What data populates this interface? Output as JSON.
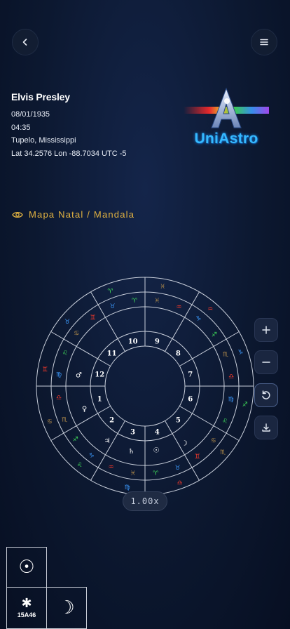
{
  "nav": {
    "back_icon": "chevron-left-icon",
    "menu_icon": "hamburger-menu-icon"
  },
  "profile": {
    "name": "Elvis Presley",
    "date": "08/01/1935",
    "time": "04:35",
    "place": "Tupelo, Mississippi",
    "coords": "Lat 34.2576 Lon -88.7034 UTC -5"
  },
  "brand": {
    "logo_text": "UniAstro"
  },
  "section": {
    "icon": "eye-icon",
    "title": "Mapa Natal / Mandala"
  },
  "houses": [
    "1",
    "2",
    "3",
    "4",
    "5",
    "6",
    "7",
    "8",
    "9",
    "10",
    "11",
    "12"
  ],
  "zoom": {
    "level": "1.00x"
  },
  "controls": {
    "zoom_in": "plus-icon",
    "zoom_out": "minus-icon",
    "reset": "rotate-ccw-icon",
    "download": "download-icon"
  },
  "aspect_grid": {
    "sun": "☉",
    "moon": "☽",
    "asc_symbol": "✱",
    "asc_label": "15A46"
  },
  "colors": {
    "accent": "#e3b341",
    "logo": "#35b9ff",
    "fire": "#ff3a2a",
    "earth": "#b08a4a",
    "air": "#3fdc5a",
    "water": "#3c9bff"
  }
}
